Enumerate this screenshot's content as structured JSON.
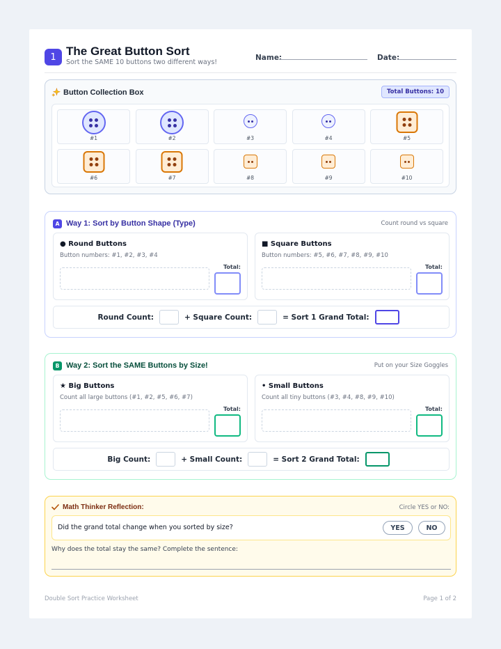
{
  "header": {
    "number": "1",
    "title": "The Great Button Sort",
    "subtitle": "Sort the SAME 10 buttons two different ways!",
    "name_label": "Name:",
    "date_label": "Date:"
  },
  "collection": {
    "title": "Button Collection Box",
    "total_label": "Total Buttons: 10",
    "buttons": [
      {
        "label": "#1",
        "shape": "round",
        "size": "big"
      },
      {
        "label": "#2",
        "shape": "round",
        "size": "big"
      },
      {
        "label": "#3",
        "shape": "round",
        "size": "small"
      },
      {
        "label": "#4",
        "shape": "round",
        "size": "small"
      },
      {
        "label": "#5",
        "shape": "square",
        "size": "big"
      },
      {
        "label": "#6",
        "shape": "square",
        "size": "big"
      },
      {
        "label": "#7",
        "shape": "square",
        "size": "big"
      },
      {
        "label": "#8",
        "shape": "square",
        "size": "small"
      },
      {
        "label": "#9",
        "shape": "square",
        "size": "small"
      },
      {
        "label": "#10",
        "shape": "square",
        "size": "small"
      }
    ]
  },
  "way1": {
    "tag": "A",
    "title": "Way 1: Sort by Button Shape (Type)",
    "hint": "Count round vs square",
    "accent": "#4f46e5",
    "left": {
      "title": "● Round Buttons",
      "sub": "Button numbers: #1, #2, #3, #4",
      "total": "Total:"
    },
    "right": {
      "title": "■ Square Buttons",
      "sub": "Button numbers: #5, #6, #7, #8, #9, #10",
      "total": "Total:"
    },
    "count_a": "Round Count:",
    "count_b": "+ Square Count:",
    "count_c": "= Sort 1 Grand Total:"
  },
  "way2": {
    "tag": "B",
    "title": "Way 2: Sort the SAME Buttons by Size!",
    "hint": "Put on your Size Goggles",
    "accent": "#059669",
    "left": {
      "title": "★ Big Buttons",
      "sub": "Count all large buttons (#1, #2, #5, #6, #7)",
      "total": "Total:"
    },
    "right": {
      "title": "• Small Buttons",
      "sub": "Count all tiny buttons (#3, #4, #8, #9, #10)",
      "total": "Total:"
    },
    "count_a": "Big Count:",
    "count_b": "+ Small Count:",
    "count_c": "= Sort 2 Grand Total:"
  },
  "reflection": {
    "title": "Math Thinker Reflection:",
    "hint": "Circle YES or NO:",
    "question": "Did the grand total change when you sorted by size?",
    "yes": "YES",
    "no": "NO",
    "why": "Why does the total stay the same? Complete the sentence:"
  },
  "footer": {
    "left": "Double Sort Practice Worksheet",
    "right": "Page 1 of 2"
  }
}
